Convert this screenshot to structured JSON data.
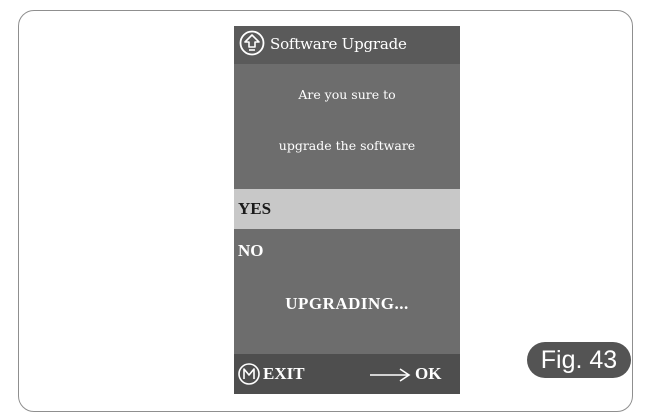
{
  "screen": {
    "title": "Software Upgrade",
    "title_icon": "upgrade-arrow-up-icon",
    "message_line1": "Are you sure to",
    "message_line2": "upgrade the software",
    "options": [
      {
        "label": "YES",
        "selected": true
      },
      {
        "label": "NO",
        "selected": false
      }
    ],
    "status": "UPGRADING...",
    "footer": {
      "exit_icon": "m-circle-icon",
      "exit_label": "EXIT",
      "ok_icon": "right-arrow-icon",
      "ok_label": "OK"
    }
  },
  "figure_label": "Fig. 43",
  "colors": {
    "screen_bg": "#6d6d6d",
    "title_bg": "#5a5a5a",
    "selected_bg": "#c8c8c8",
    "footer_bg": "#4e4e4e",
    "badge_bg": "#545454"
  }
}
